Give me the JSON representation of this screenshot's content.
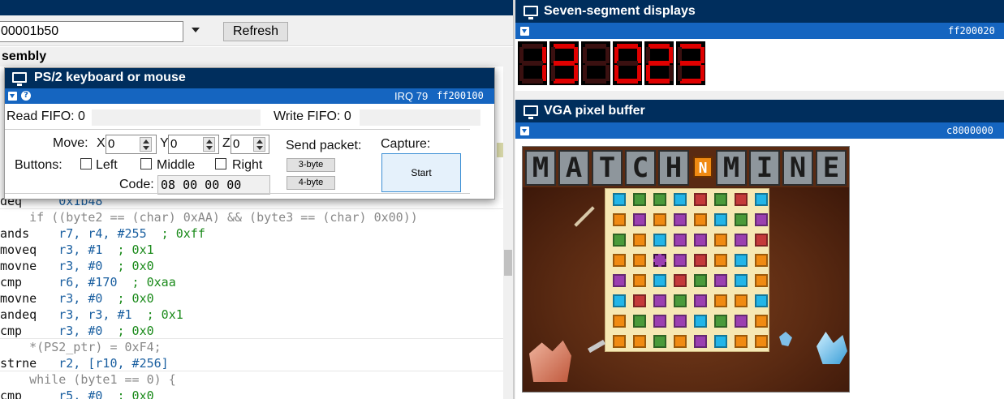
{
  "disassembly": {
    "address_value": "00001b50",
    "refresh_label": "Refresh",
    "header": "sembly",
    "lines": [
      {
        "kind": "asm",
        "mnemonic": "deq",
        "operands": "0x1b48"
      },
      {
        "kind": "src",
        "text": "    if ((byte2 == (char) 0xAA) && (byte3 == (char) 0x00))"
      },
      {
        "kind": "asm",
        "mnemonic": "ands",
        "operands": "r7, r4, #255",
        "comment": "; 0xff"
      },
      {
        "kind": "asm",
        "mnemonic": "moveq",
        "operands": "r3, #1",
        "comment": "; 0x1"
      },
      {
        "kind": "asm",
        "mnemonic": "movne",
        "operands": "r3, #0",
        "comment": "; 0x0"
      },
      {
        "kind": "asm",
        "mnemonic": "cmp",
        "operands": "r6, #170",
        "comment": "; 0xaa"
      },
      {
        "kind": "asm",
        "mnemonic": "movne",
        "operands": "r3, #0",
        "comment": "; 0x0"
      },
      {
        "kind": "asm",
        "mnemonic": "andeq",
        "operands": "r3, r3, #1",
        "comment": "; 0x1"
      },
      {
        "kind": "asm",
        "mnemonic": "cmp",
        "operands": "r3, #0",
        "comment": "; 0x0"
      },
      {
        "kind": "src",
        "text": "    *(PS2_ptr) = 0xF4;"
      },
      {
        "kind": "asm",
        "mnemonic": "strne",
        "operands": "r2, [r10, #256]"
      },
      {
        "kind": "src",
        "text": "    while (byte1 == 0) {"
      },
      {
        "kind": "asm",
        "mnemonic": "cmp",
        "operands": "r5, #0",
        "comment": "; 0x0"
      }
    ]
  },
  "ps2": {
    "title": "PS/2 keyboard or mouse",
    "irq": "IRQ 79",
    "address": "ff200100",
    "read_fifo_label": "Read FIFO: 0",
    "write_fifo_label": "Write FIFO: 0",
    "move_label": "Move:",
    "x_label": "X",
    "x_value": "0",
    "y_label": "Y",
    "y_value": "0",
    "z_label": "Z",
    "z_value": "0",
    "buttons_label": "Buttons:",
    "left_label": "Left",
    "middle_label": "Middle",
    "right_label": "Right",
    "code_label": "Code:",
    "code_value": "08 00 00 00",
    "send_packet_label": "Send packet:",
    "three_byte_label": "3-byte",
    "four_byte_label": "4-byte",
    "capture_label": "Capture:",
    "start_label": "Start",
    "left_checked": false,
    "middle_checked": false,
    "right_checked": false
  },
  "seven_segment": {
    "title": "Seven-segment displays",
    "address": "ff200020",
    "digits": [
      "1",
      "3",
      "",
      "0",
      "2",
      "3"
    ],
    "on_color": "#e00000",
    "off_color": "#3a1010"
  },
  "vga": {
    "title": "VGA pixel buffer",
    "address": "c8000000",
    "game_title_left": [
      "M",
      "A",
      "T",
      "C",
      "H"
    ],
    "game_title_right": [
      "M",
      "I",
      "N",
      "E"
    ],
    "game_badge": "N",
    "board": [
      [
        "cyan",
        "green",
        "green",
        "cyan",
        "red",
        "green",
        "red",
        "cyan"
      ],
      [
        "orange",
        "purple",
        "orange",
        "purple",
        "orange",
        "cyan",
        "green",
        "purple"
      ],
      [
        "green",
        "orange",
        "cyan",
        "purple",
        "purple",
        "orange",
        "purple",
        "red"
      ],
      [
        "orange",
        "orange",
        "cursor",
        "purple",
        "red",
        "orange",
        "cyan",
        "orange"
      ],
      [
        "purple",
        "orange",
        "cyan",
        "red",
        "green",
        "purple",
        "cyan",
        "orange"
      ],
      [
        "cyan",
        "red",
        "purple",
        "green",
        "purple",
        "orange",
        "orange",
        "cyan"
      ],
      [
        "orange",
        "green",
        "purple",
        "purple",
        "cyan",
        "green",
        "purple",
        "orange"
      ],
      [
        "orange",
        "orange",
        "green",
        "orange",
        "purple",
        "cyan",
        "orange",
        "orange"
      ]
    ],
    "tile_colors": {
      "cyan": "#22b5e8",
      "green": "#4a9a3a",
      "red": "#c43a3a",
      "orange": "#f08a12",
      "purple": "#9b3fb0",
      "cursor": "#9b3fb0"
    }
  },
  "icons": {
    "window": "monitor-icon",
    "dropdown": "chevron-down-icon",
    "help": "help-icon"
  }
}
